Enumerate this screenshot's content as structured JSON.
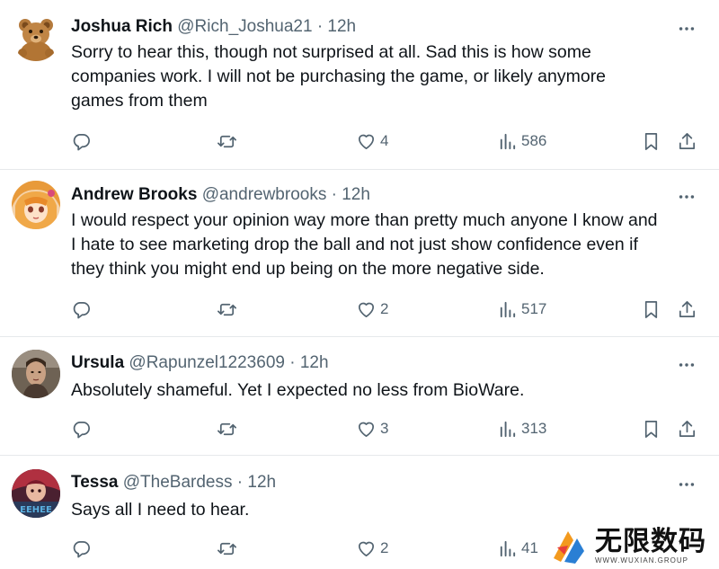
{
  "tweets": [
    {
      "name": "Joshua Rich",
      "handle": "@Rich_Joshua21",
      "dot": "·",
      "time": "12h",
      "avatar": "teddy-bear-avatar",
      "lines": [
        "Sorry to hear this, though not surprised at all.  Sad this is how some",
        "companies work.  I will not be purchasing the game, or likely anymore",
        "games from them"
      ],
      "replies": "",
      "reposts": "",
      "likes": "4",
      "views": "586"
    },
    {
      "name": "Andrew Brooks",
      "handle": "@andrewbrooks",
      "dot": "·",
      "time": "12h",
      "avatar": "anime-girl-avatar",
      "lines": [
        "I would respect your opinion way more than pretty much anyone I know and",
        "I hate to see marketing drop the ball and not just show confidence even if",
        "they think you might end up being on the more negative side."
      ],
      "replies": "",
      "reposts": "",
      "likes": "2",
      "views": "517"
    },
    {
      "name": "Ursula",
      "handle": "@Rapunzel1223609",
      "dot": "·",
      "time": "12h",
      "avatar": "portrait-avatar",
      "lines": [
        "Absolutely shameful. Yet I expected no less from BioWare."
      ],
      "replies": "",
      "reposts": "",
      "likes": "3",
      "views": "313"
    },
    {
      "name": "Tessa",
      "handle": "@TheBardess",
      "dot": "·",
      "time": "12h",
      "avatar": "character-art-avatar",
      "avatar_text": "EEHEE",
      "lines": [
        "Says all I need to hear."
      ],
      "replies": "",
      "reposts": "",
      "likes": "2",
      "views": "41"
    }
  ],
  "icons": {
    "reply": "reply-icon",
    "repost": "repost-icon",
    "like": "heart-icon",
    "views": "views-icon",
    "bookmark": "bookmark-icon",
    "share": "share-icon",
    "more": "more-icon"
  },
  "colors": {
    "text": "#0f1419",
    "secondary": "#536471",
    "divider": "#e6e9eb"
  },
  "watermark": {
    "title": "无限数码",
    "subtitle": "WWW.WUXIAN.GROUP"
  }
}
